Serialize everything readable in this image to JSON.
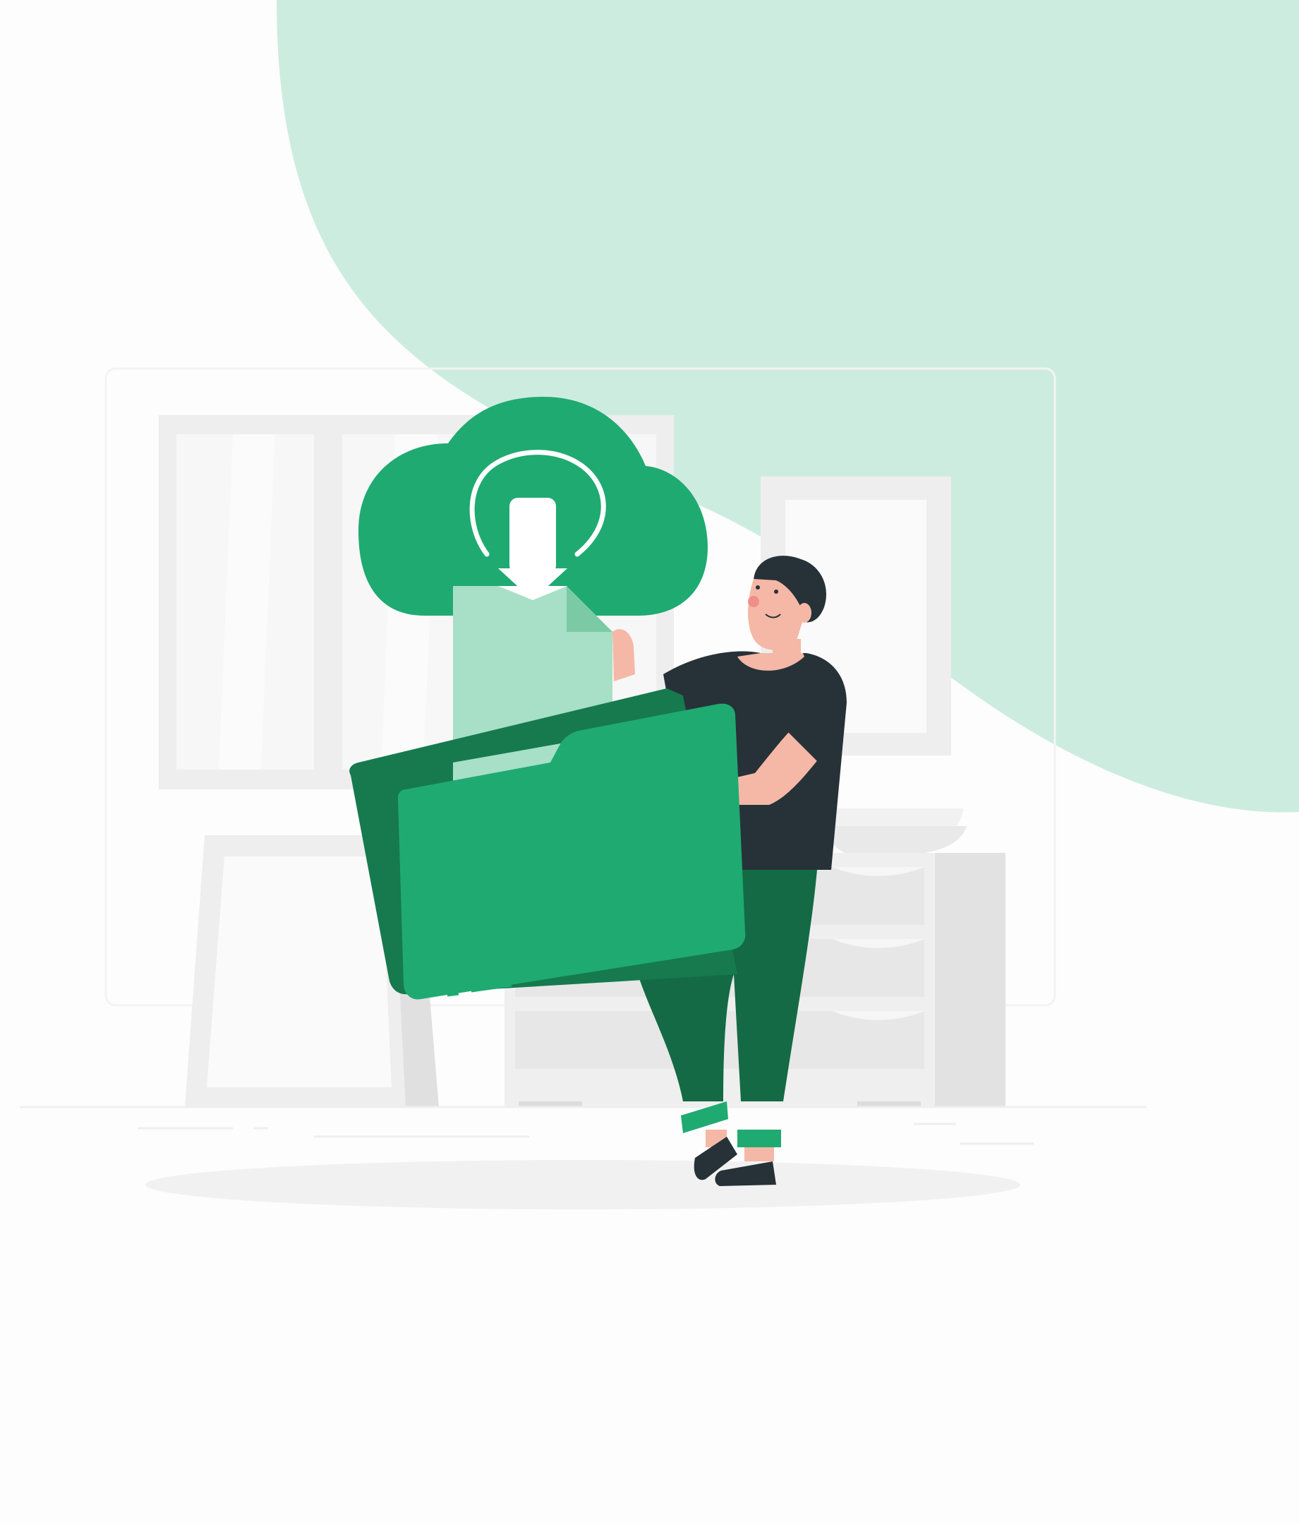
{
  "illustration": {
    "subject": "cloud-download-folder",
    "icons": [
      "cloud-icon",
      "download-arrow-icon",
      "document-icon",
      "folder-icon"
    ]
  },
  "colors": {
    "background": "#fdfdfd",
    "blob": "#cdece0",
    "primary_green": "#1faa72",
    "dark_green": "#167a4e",
    "pants_green": "#146a44",
    "light_green": "#a7dfc7",
    "shirt": "#263238",
    "skin": "#f5b8a6",
    "room_grey": "#eeeeee",
    "room_light": "#f5f5f5"
  }
}
